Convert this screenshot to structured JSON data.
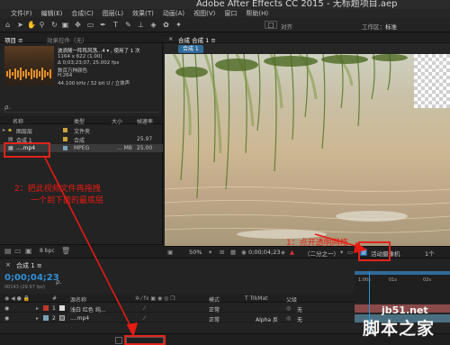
{
  "window": {
    "title": "Adobe After Effects CC 2015 - 无标题项目.aep"
  },
  "menu": [
    "文件(F)",
    "编辑(E)",
    "合成(C)",
    "图层(L)",
    "效果(T)",
    "动画(A)",
    "视图(V)",
    "窗口",
    "帮助(H)"
  ],
  "toolbar": {
    "align_label": "对齐",
    "workspace_label": "工作区：",
    "workspace_value": "标准"
  },
  "project_panel": {
    "tab_project": "项目 ≡",
    "tab_effects": "效果控件（无）",
    "item_name": "波浪随一阵阵风荡...4 ▾ , 使用了 1 次",
    "info_lines": [
      "1164 x 622 (1.00)",
      "Δ 0;03;23;07, 25.002 fps",
      "数百万种颜色",
      "H.264",
      "44.100 kHz / 32 bit U / 立体声"
    ],
    "search_placeholder": "ρ.",
    "columns": {
      "name": "名称",
      "type": "类型",
      "size": "大小",
      "rate": "帧速率"
    },
    "rows": [
      {
        "name": "图层层",
        "type": "文件夹",
        "size": "",
        "rate": "",
        "color": "#c8a43d"
      },
      {
        "name": "合成 1",
        "type": "合成",
        "size": "",
        "rate": "25.97",
        "color": "#c8a43d"
      },
      {
        "name": "....mp4",
        "type": "MPEG",
        "size": "... MB",
        "rate": "25.00",
        "color": "#7aa3b6"
      }
    ],
    "footer": {
      "bpc_label": "8 bpc"
    }
  },
  "composition_panel": {
    "tab_label": "合成  合成 1 ≡",
    "comp_chip": "合成 1",
    "bottom": {
      "zoom": "50%",
      "timecode": "0;00;04;23",
      "resolution": "（二分之一）",
      "camera": "活动摄像机",
      "views": "1个"
    }
  },
  "timeline": {
    "tab_label": "合成 1 ≡",
    "timecode": "0;00;04;23",
    "fps_hint": "00143 (29.97 fps)",
    "columns": {
      "num": "#",
      "source": "源名称",
      "mode": "模式",
      "trkmat": "T  TrkMat",
      "parent": "父级"
    },
    "ruler_labels": [
      "1:00s",
      "01s",
      "02s"
    ],
    "layers": [
      {
        "num": "1",
        "name": "浅白 红色 纯...",
        "mode": "正常",
        "trkmat": "",
        "parent": "无",
        "color": "#c0392b"
      },
      {
        "num": "2",
        "name": "....mp4",
        "mode": "正常",
        "trkmat": "Alpha 反",
        "parent": "无",
        "color": "#7aa3b6"
      }
    ]
  },
  "annotations": {
    "step1": "1：点开透明网格",
    "step2_line1": "2：把此视频文件再拖拽",
    "step2_line2": "一个到下面的最底层"
  },
  "watermark": {
    "small": "jb51.net",
    "big": "脚本之家"
  },
  "colors": {
    "accent_blue": "#2f8fd8",
    "annotation_red": "#e61b13",
    "panel_bg": "#232323"
  }
}
